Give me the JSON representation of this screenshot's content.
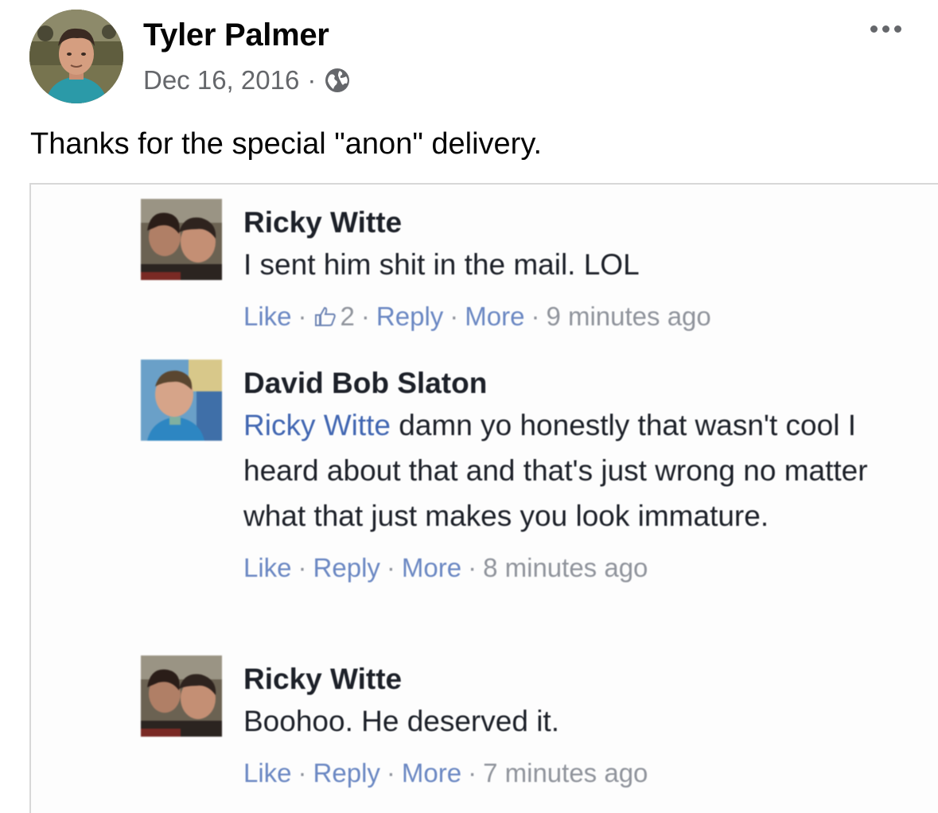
{
  "post": {
    "author": "Tyler Palmer",
    "date": "Dec 16, 2016",
    "separator": "·",
    "privacy_icon": "globe-icon",
    "more_icon": "more-horizontal-icon",
    "text": "Thanks for the special \"anon\" delivery."
  },
  "comments": [
    {
      "name": "Ricky Witte",
      "mention": "",
      "text": "I sent him shit in the mail. LOL",
      "like_label": "Like",
      "like_count": "2",
      "reply_label": "Reply",
      "more_label": "More",
      "time": "9 minutes ago"
    },
    {
      "name": "David Bob Slaton",
      "mention": "Ricky Witte",
      "text": " damn yo honestly that wasn't cool I heard about that and that's just wrong no matter what that just makes you look immature.",
      "like_label": "Like",
      "like_count": "",
      "reply_label": "Reply",
      "more_label": "More",
      "time": "8 minutes ago"
    },
    {
      "name": "Ricky Witte",
      "mention": "",
      "text": "Boohoo. He deserved it.",
      "like_label": "Like",
      "like_count": "",
      "reply_label": "Reply",
      "more_label": "More",
      "time": "7 minutes ago"
    }
  ],
  "colors": {
    "link_blue": "#4267b2",
    "meta_gray": "#65676b",
    "action_gray": "#90949c"
  }
}
